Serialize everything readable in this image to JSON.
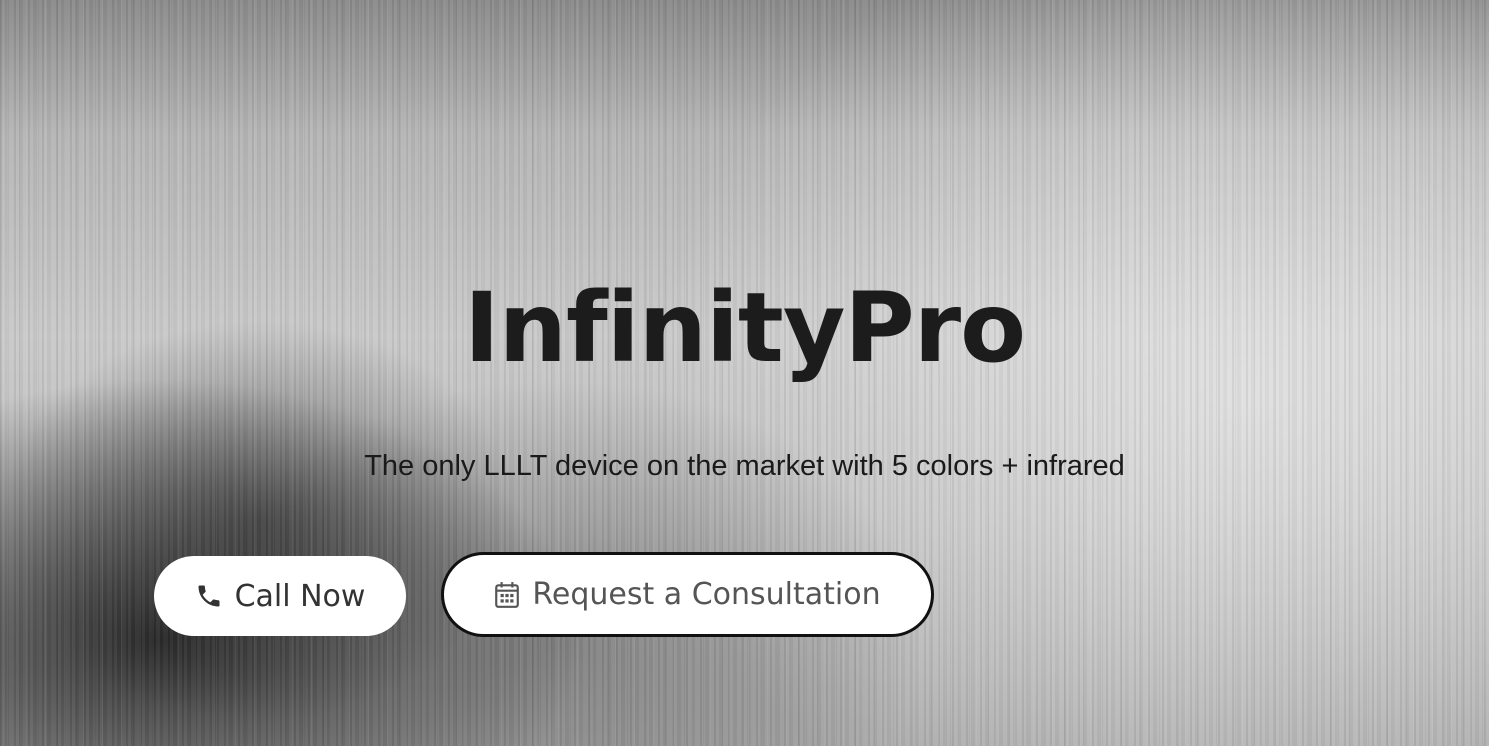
{
  "hero": {
    "title": "InfinityPro",
    "subtitle": "The only LLLT device on the market with 5 colors + infrared",
    "buttons": {
      "call": {
        "label": "Call Now",
        "icon": "phone-icon"
      },
      "consult": {
        "label": "Request a Consultation",
        "icon": "calendar-icon"
      }
    }
  },
  "colors": {
    "title": "#1c1c1c",
    "button_bg": "#ffffff",
    "button_border": "#111111"
  }
}
